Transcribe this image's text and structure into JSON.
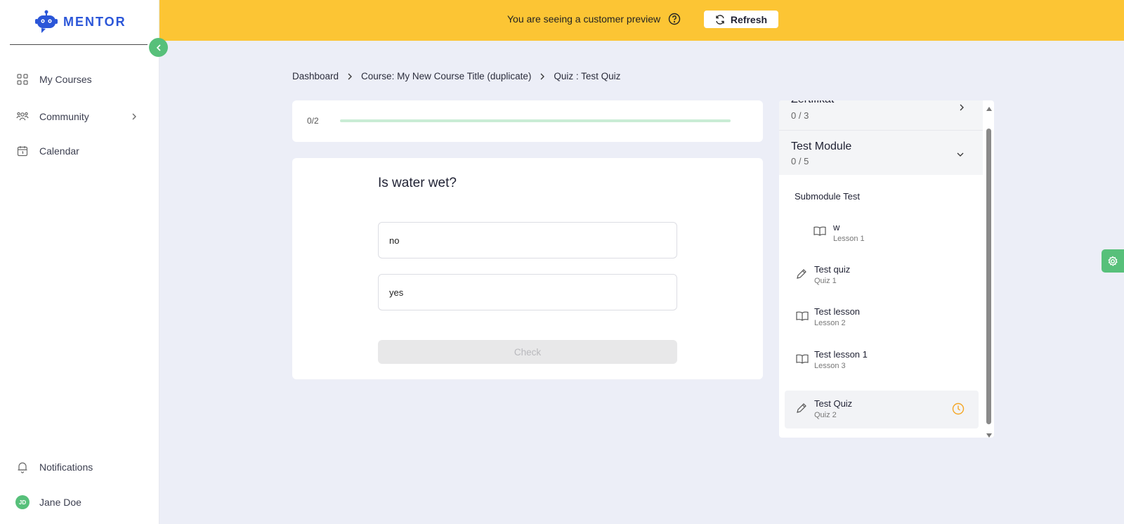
{
  "brand": {
    "name": "MENTOR"
  },
  "sidebar": {
    "items": [
      {
        "label": "My Courses",
        "icon": "grid-icon"
      },
      {
        "label": "Community",
        "icon": "people-icon"
      },
      {
        "label": "Calendar",
        "icon": "calendar-icon"
      }
    ],
    "bottom": {
      "notifications": "Notifications",
      "user_name": "Jane Doe",
      "user_initials": "JD"
    }
  },
  "banner": {
    "text": "You are seeing a customer preview",
    "refresh_label": "Refresh"
  },
  "breadcrumb": {
    "items": [
      "Dashboard",
      "Course: My New Course Title (duplicate)",
      "Quiz : Test Quiz"
    ]
  },
  "progress": {
    "label": "0/2",
    "fraction": 0
  },
  "question": {
    "title": "Is water wet?",
    "answers": [
      "no",
      "yes"
    ],
    "check_label": "Check"
  },
  "course_outline": {
    "modules": [
      {
        "title": "Zertifikat",
        "count": "0 / 3"
      },
      {
        "title": "Test Module",
        "count": "0 / 5"
      }
    ],
    "submodule_title": "Submodule Test",
    "lessons": [
      {
        "title": "w",
        "sub": "Lesson 1",
        "icon": "book-icon"
      },
      {
        "title": "Test quiz",
        "sub": "Quiz 1",
        "icon": "pencil-icon"
      },
      {
        "title": "Test lesson",
        "sub": "Lesson 2",
        "icon": "book-icon"
      },
      {
        "title": "Test lesson 1",
        "sub": "Lesson 3",
        "icon": "book-icon"
      },
      {
        "title": "Test Quiz",
        "sub": "Quiz 2",
        "icon": "pencil-icon"
      }
    ]
  },
  "colors": {
    "accent_green": "#57c07a",
    "banner_yellow": "#fcc534",
    "brand_blue": "#2b56d8",
    "pending_orange": "#f5a623"
  }
}
